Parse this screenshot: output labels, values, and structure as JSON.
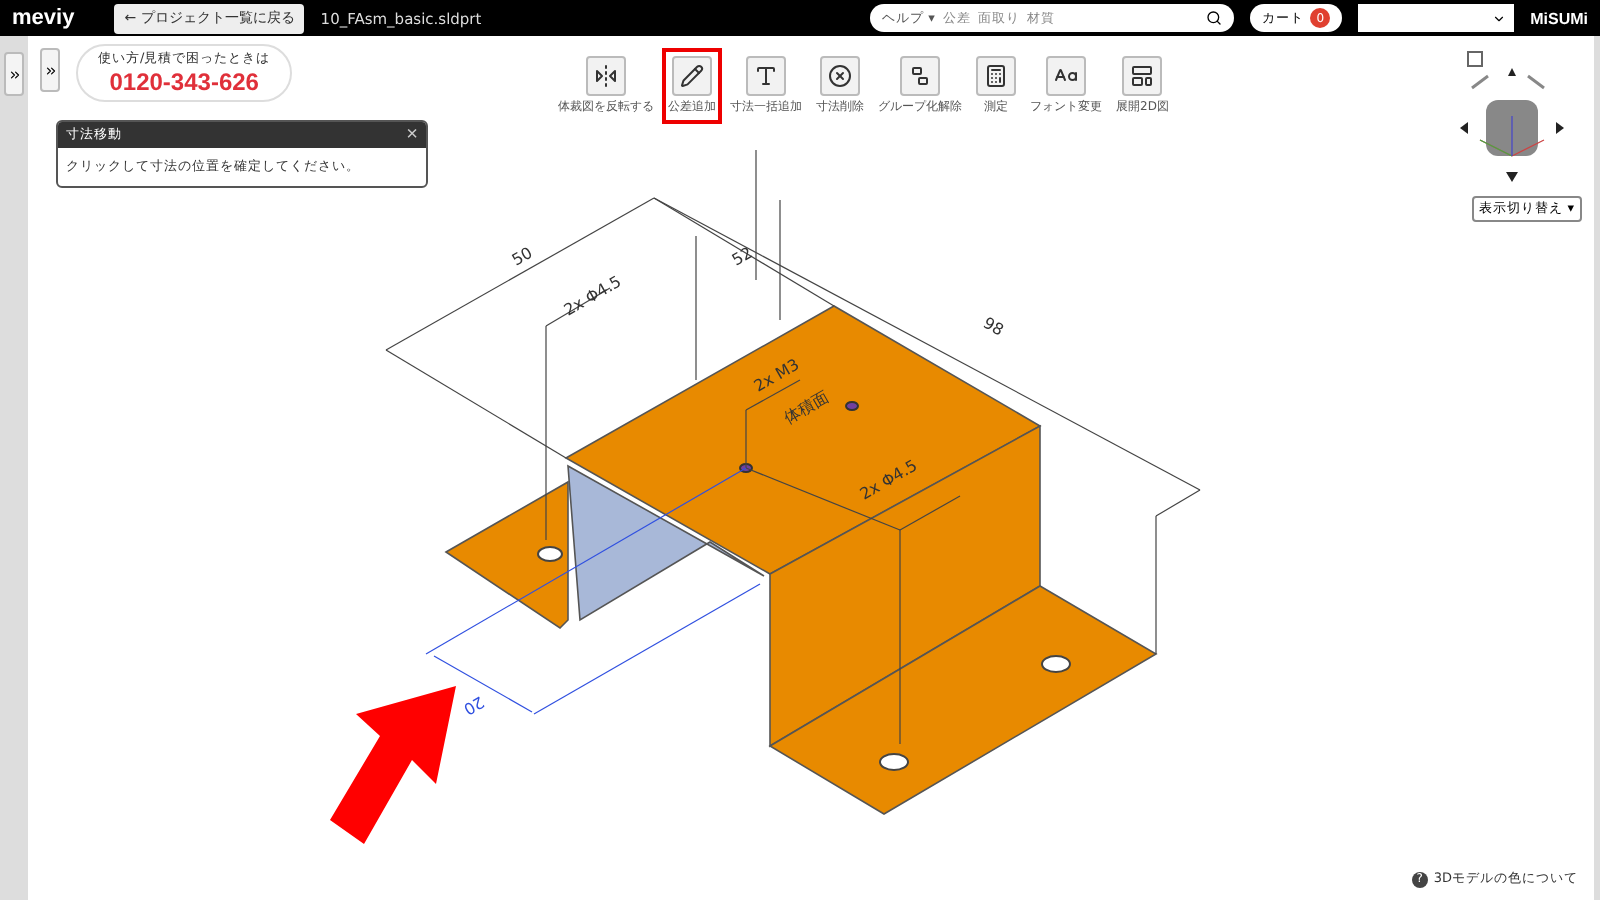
{
  "header": {
    "logo": "meviy",
    "back_button": "← プロジェクト一覧に戻る",
    "file_name": "10_FAsm_basic.sldprt",
    "search": {
      "scope": "ヘルプ ▾",
      "placeholder": "公差  面取り  材質"
    },
    "cart": {
      "label": "カート",
      "count": "0"
    },
    "brand": "MiSUMi"
  },
  "support": {
    "caption": "使い方/見積で困ったときは",
    "phone": "0120-343-626"
  },
  "toolbar": [
    {
      "label": "体裁図を反転する",
      "selected": false
    },
    {
      "label": "公差追加",
      "selected": true
    },
    {
      "label": "寸法一括追加",
      "selected": false
    },
    {
      "label": "寸法削除",
      "selected": false
    },
    {
      "label": "グループ化解除",
      "selected": false
    },
    {
      "label": "測定",
      "selected": false
    },
    {
      "label": "フォント変更",
      "selected": false
    },
    {
      "label": "展開2D図",
      "selected": false
    }
  ],
  "message_panel": {
    "title": "寸法移動",
    "close": "×",
    "text": "クリックして寸法の位置を確定してください。"
  },
  "view_control": {
    "switch": "表示切り替え ▾"
  },
  "drawing": {
    "labels": [
      "50",
      "2x Φ4.5",
      "52",
      "98",
      "2x M3",
      "体積面",
      "2x Φ4.5",
      "20"
    ]
  },
  "help_link": {
    "icon": "?",
    "text": "3Dモデルの色について"
  }
}
